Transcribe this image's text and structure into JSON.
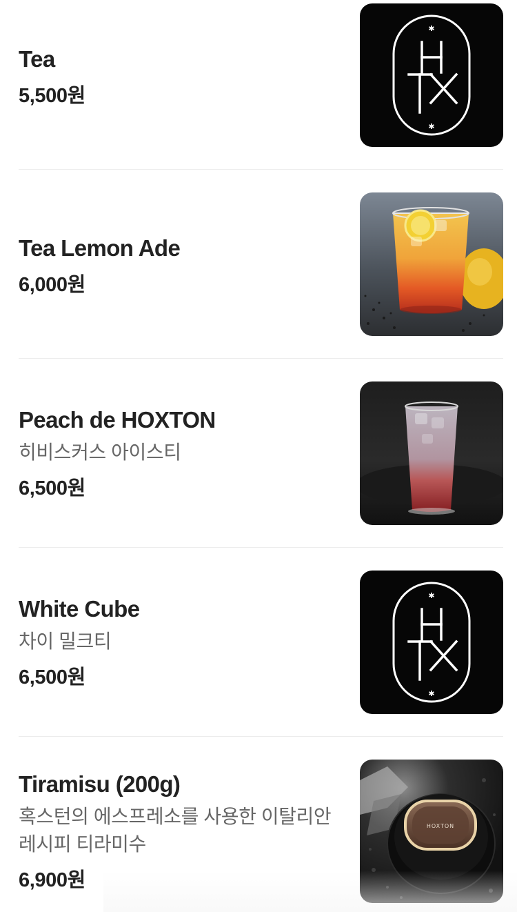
{
  "menu": {
    "items": [
      {
        "name": "Tea",
        "description": "",
        "price": "5,500원",
        "image": "hoxton-logo"
      },
      {
        "name": "Tea Lemon Ade",
        "description": "",
        "price": "6,000원",
        "image": "lemonade-photo"
      },
      {
        "name": "Peach de HOXTON",
        "description": "히비스커스 아이스티",
        "price": "6,500원",
        "image": "hibiscus-iced-tea-photo"
      },
      {
        "name": "White Cube",
        "description": "차이 밀크티",
        "price": "6,500원",
        "image": "hoxton-logo"
      },
      {
        "name": "Tiramisu (200g)",
        "description": "혹스턴의 에스프레소를 사용한 이탈리안 레시피 티라미수",
        "price": "6,900원",
        "image": "tiramisu-photo"
      }
    ],
    "logo_text": {
      "left_letter": "H",
      "center_letters": "TX",
      "jar_label": "HOXTON"
    }
  },
  "colors": {
    "logo_bg": "#060606",
    "logo_stroke": "#ffffff",
    "divider": "#ececec",
    "text": "#222222",
    "desc": "#666666"
  }
}
